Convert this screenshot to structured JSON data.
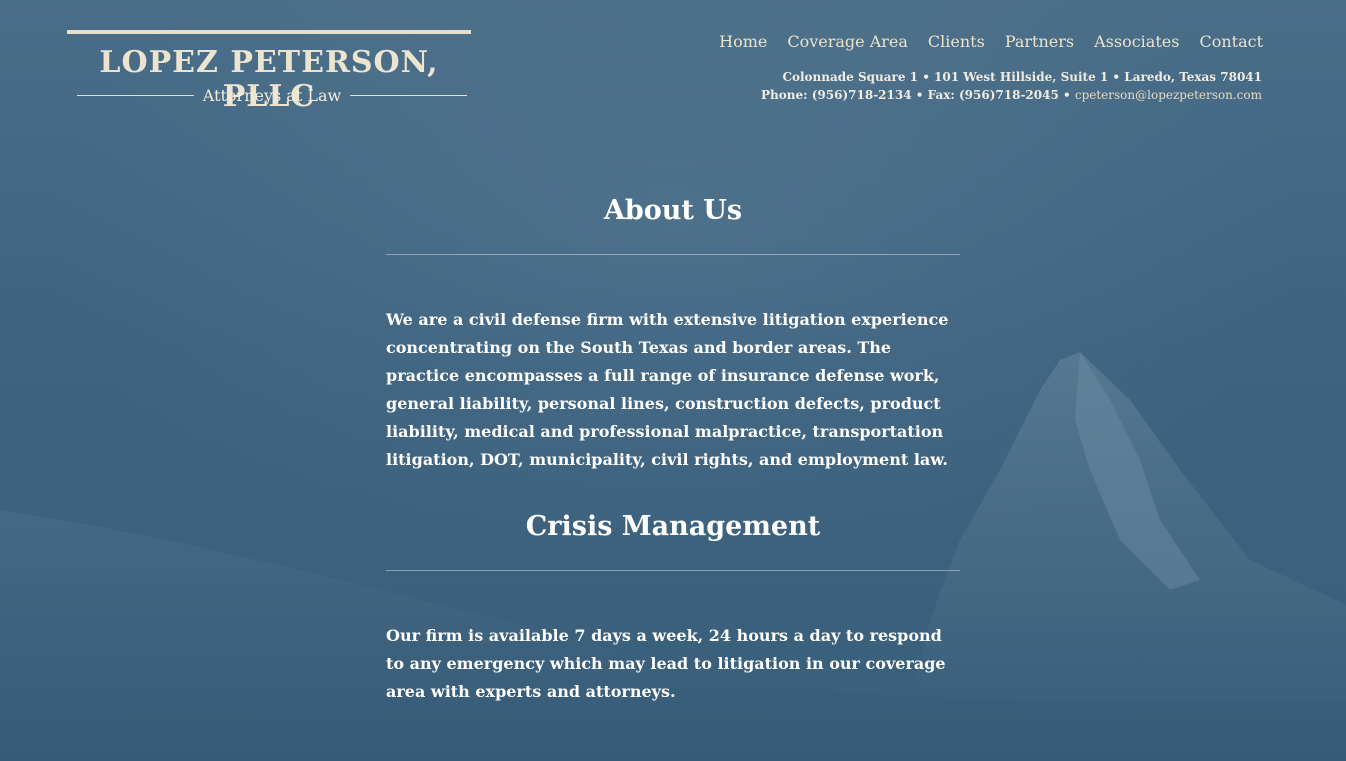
{
  "brand": {
    "name": "LOPEZ PETERSON, PLLC",
    "tagline": "Attorneys at Law"
  },
  "nav": {
    "items": [
      {
        "label": "Home"
      },
      {
        "label": "Coverage Area"
      },
      {
        "label": "Clients"
      },
      {
        "label": "Partners"
      },
      {
        "label": "Associates"
      },
      {
        "label": "Contact"
      }
    ]
  },
  "contact": {
    "address": "Colonnade Square 1 • 101 West Hillside, Suite 1 • Laredo, Texas 78041",
    "phone_fax": "Phone: (956)718-2134 • Fax: (956)718-2045 •",
    "email": "cpeterson@lopezpeterson.com"
  },
  "sections": [
    {
      "title": "About Us",
      "body": "We are a civil defense firm with extensive litigation experience concentrating on the South Texas and border areas. The practice encompasses a full range of insurance defense work, general liability, personal lines, construction defects, product liability, medical and professional malpractice, transportation litigation, DOT, municipality, civil rights, and employment law."
    },
    {
      "title": "Crisis Management",
      "body": "Our firm is available 7 days a week, 24 hours a day to respond to any emergency which may lead to litigation in our coverage area with experts and attorneys."
    }
  ],
  "colors": {
    "background": "#3f627d",
    "accent_cream": "#ece3c9",
    "text": "#ffffff"
  }
}
